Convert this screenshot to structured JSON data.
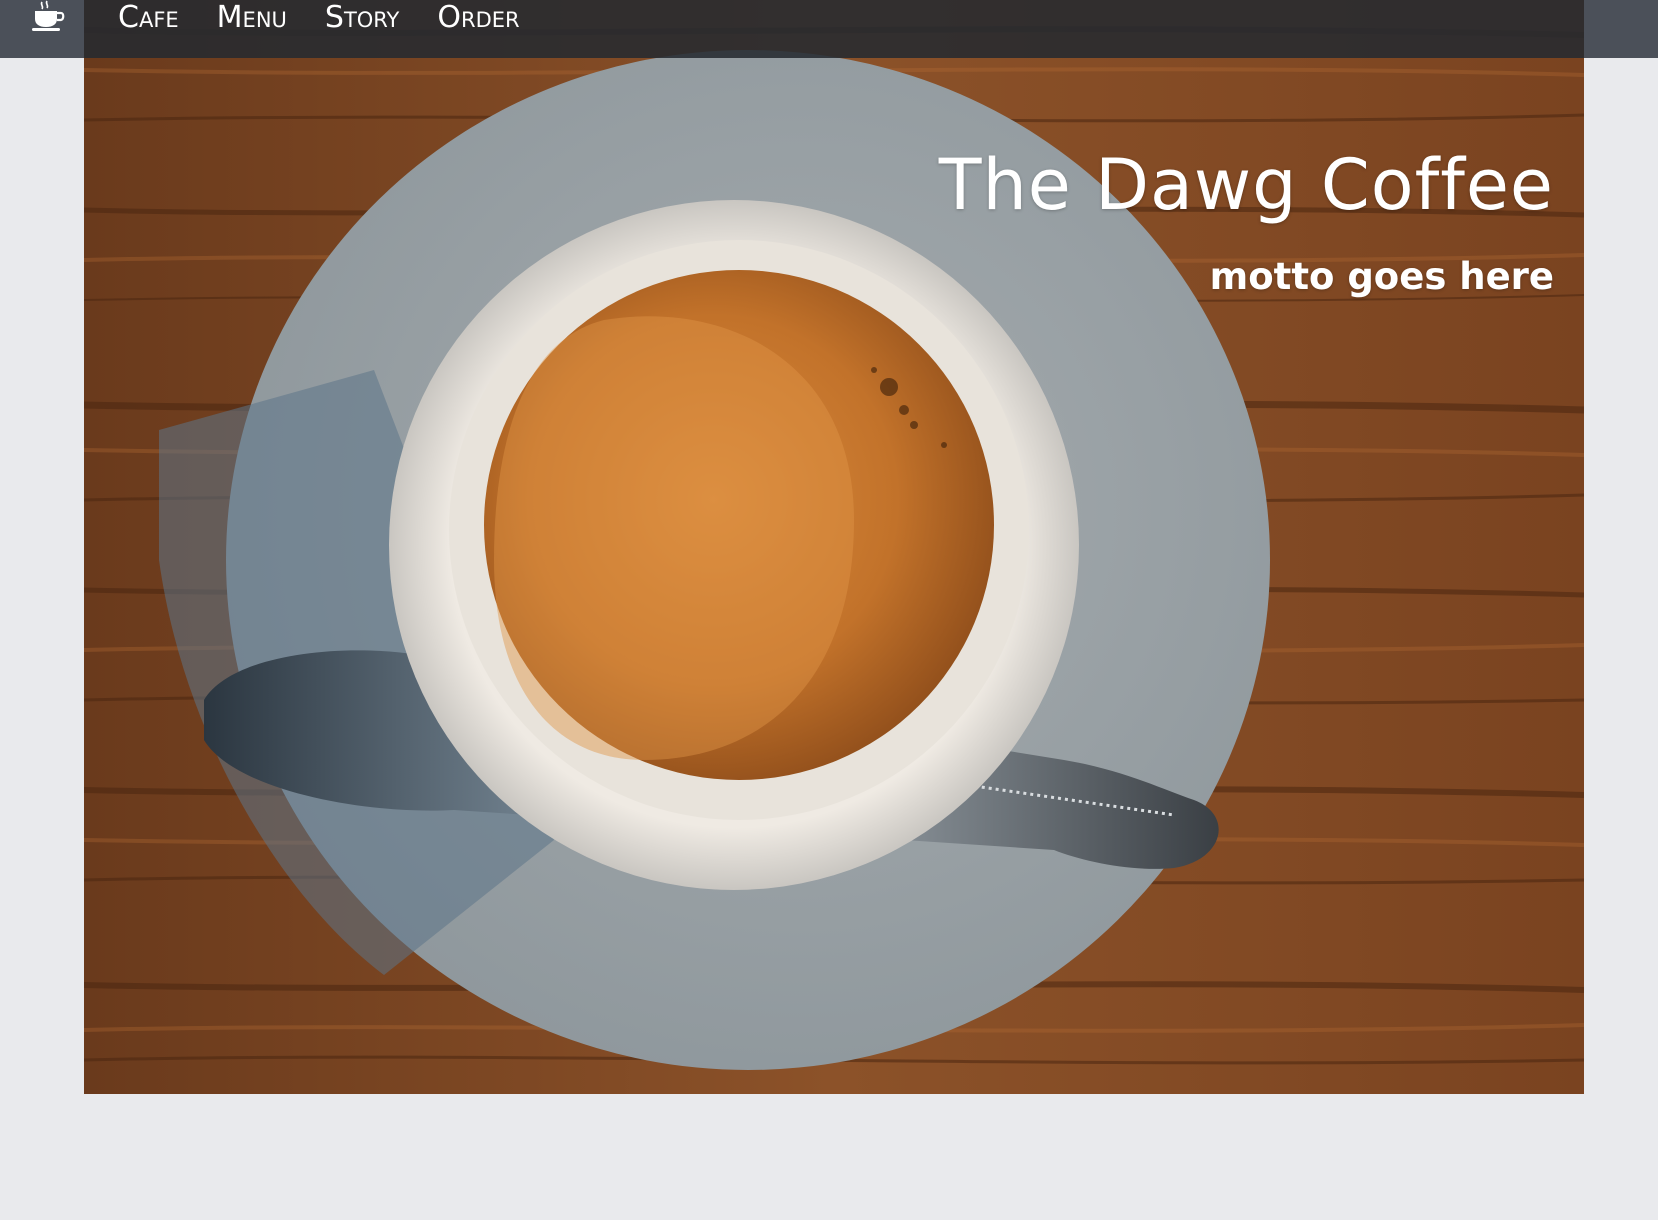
{
  "nav": {
    "brand_icon": "coffee-cup-icon",
    "links": [
      {
        "label": "Cafe"
      },
      {
        "label": "Menu"
      },
      {
        "label": "Story"
      },
      {
        "label": "Order"
      }
    ]
  },
  "hero": {
    "image": "coffee-cup-on-saucer-photo",
    "title": "The Dawg Coffee",
    "motto": "motto goes here"
  },
  "colors": {
    "page_background": "#e9eaed",
    "nav_background": "#262a30",
    "nav_side_background": "#4b5059",
    "text": "#ffffff",
    "wood": "#8a4f26",
    "crema": "#c8792e"
  }
}
